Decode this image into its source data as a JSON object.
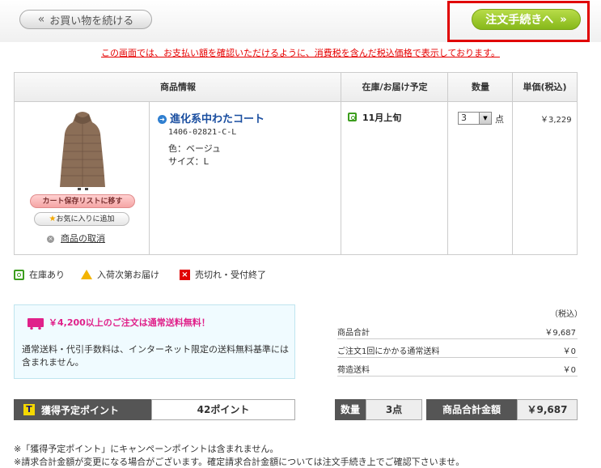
{
  "header": {
    "back_label": "お買い物を続ける",
    "proceed_label": "注文手続きへ",
    "chevron_left": "«",
    "chevron_right": "»"
  },
  "notice": "この画面では、お支払い額を確認いただけるように、消費税を含んだ税込価格で表示しております。",
  "table": {
    "headers": [
      "商品情報",
      "在庫/お届け予定",
      "数量",
      "単価(税込)"
    ]
  },
  "item": {
    "name": "進化系中わたコート",
    "code": "1406-02821-C-L",
    "color": "色：ベージュ",
    "size": "サイズ：L",
    "stock": "11月上旬",
    "quantity": "3",
    "unit": "点",
    "price": "￥3,229",
    "save_label": "カート保存リストに移す",
    "fav_label": "お気に入りに追加",
    "remove_label": "商品の取消"
  },
  "legend": [
    "在庫あり",
    "入荷次第お届け",
    "売切れ・受付終了"
  ],
  "shipping": {
    "headline": "￥4,200以上のご注文は通常送料無料！",
    "body": "通常送料・代引手数料は、インターネット限定の送料無料基準には含まれません。"
  },
  "summary": {
    "tax_note": "（税込）",
    "rows": [
      {
        "label": "商品合計",
        "value": "￥9,687"
      },
      {
        "label": "ご注文1回にかかる通常送料",
        "value": "￥0"
      },
      {
        "label": "荷造送料",
        "value": "￥0"
      }
    ]
  },
  "totals": {
    "points_label": "獲得予定ポイント",
    "points_value": "42ポイント",
    "qty_label": "数量",
    "qty_value": "3点",
    "total_label": "商品合計金額",
    "total_value": "￥9,687"
  },
  "footnotes": [
    "※「獲得予定ポイント」にキャンペーンポイントは含まれません。",
    "※請求合計金額が変更になる場合がございます。確定請求合計金額については注文手続き上でご確認下さいませ。"
  ],
  "colors": {
    "accent_green": "#86b81a",
    "notice_red": "#e60000",
    "link_blue": "#1a4ea0",
    "shipping_pink": "#e0218a"
  }
}
